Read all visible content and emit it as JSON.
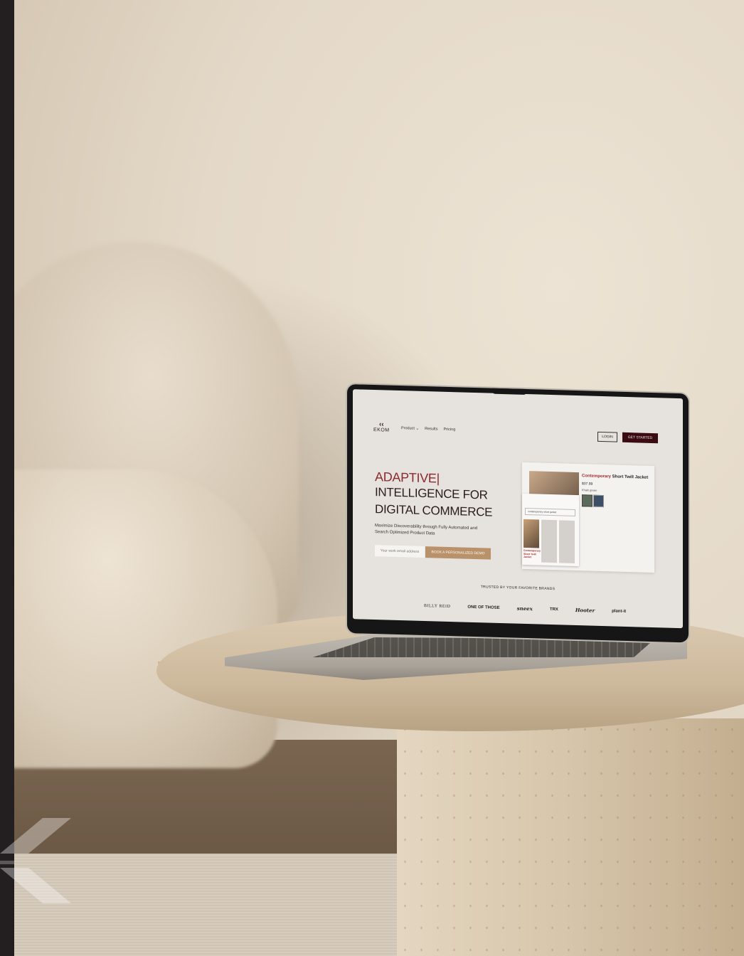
{
  "colors": {
    "left_bar": "#231f20",
    "brand_dark_red": "#3a0b10",
    "accent_red": "#8c2a2e",
    "demo_button": "#b9916a"
  },
  "site": {
    "brand_name": "EKOM",
    "nav": {
      "product": "Product",
      "product_chevron_icon": "chevron-down-icon",
      "results": "Results",
      "pricing": "Pricing"
    },
    "login": "LOGIN",
    "get_started": "GET STARTED",
    "hero": {
      "accent": "ADAPTIVE|",
      "line1": "INTELLIGENCE FOR",
      "line2": "DIGITAL COMMERCE",
      "subtitle": "Maximize Discoverability through Fully Automated and Search Optimized Product Data",
      "email_placeholder": "Your work email address",
      "cta": "BOOK A PERSONALIZED DEMO"
    },
    "product_card": {
      "title_accent": "Contemporary",
      "title_rest": " Short Twill Jacket",
      "price": "$37.99",
      "color_label": "Khaki green",
      "search_query": "contemporary short jacket",
      "result_label": "Contemporary Short Twill Jacket"
    },
    "trusted_heading": "TRUSTED BY YOUR FAVORITE BRANDS",
    "brands": [
      "BILLY REID",
      "ONE OF THOSE",
      "sneex",
      "TRX",
      "Hooter",
      "plant-it"
    ]
  }
}
